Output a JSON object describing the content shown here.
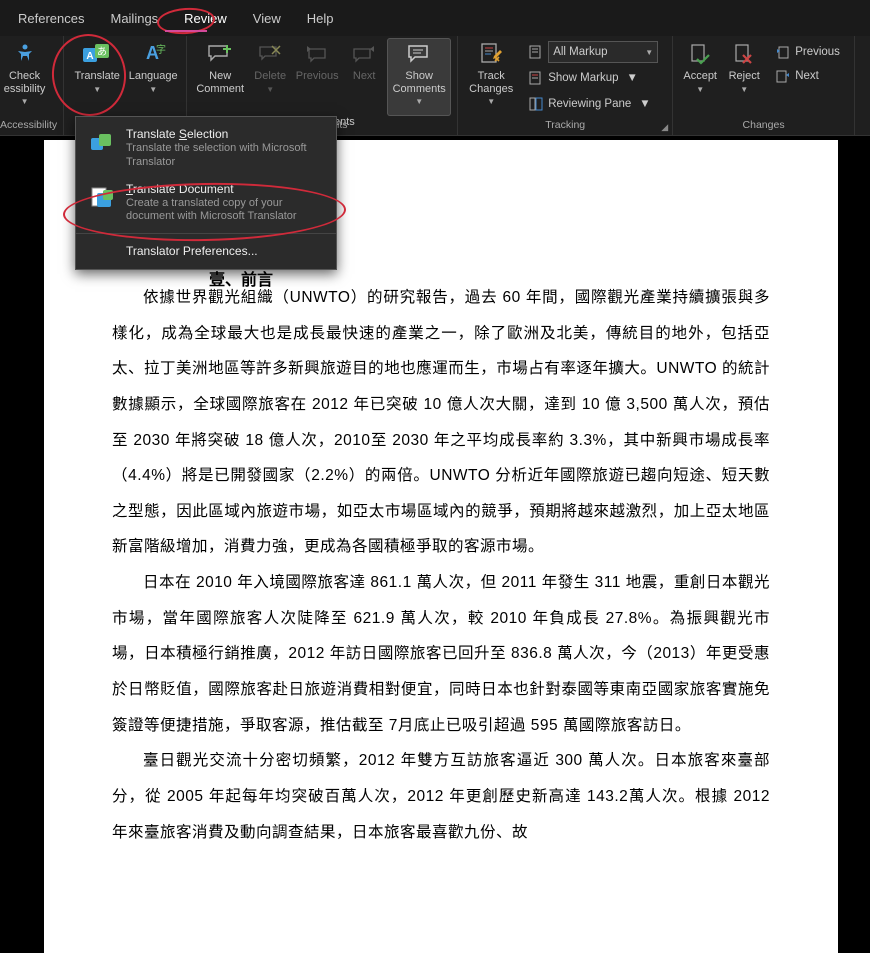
{
  "tabs": {
    "references": "References",
    "mailings": "Mailings",
    "review": "Review",
    "view": "View",
    "help": "Help"
  },
  "ribbon": {
    "check_accessibility": "Check\nessibility",
    "translate": "Translate",
    "language": "Language",
    "new_comment": "New\nComment",
    "delete": "Delete",
    "previous": "Previous",
    "next": "Next",
    "show_comments": "Show\nComments",
    "track_changes": "Track\nChanges",
    "all_markup": "All Markup",
    "show_markup": "Show Markup",
    "reviewing_pane": "Reviewing Pane",
    "accept": "Accept",
    "reject": "Reject",
    "prev2": "Previous",
    "next2": "Next",
    "group_comments_frag": "ents",
    "group_tracking": "Tracking",
    "group_changes": "Changes"
  },
  "menu": {
    "sel_title_pre": "Translate ",
    "sel_title_ul": "S",
    "sel_title_post": "election",
    "sel_desc": "Translate the selection with Microsoft Translator",
    "doc_title_ul": "T",
    "doc_title_post": "ranslate Document",
    "doc_desc": "Create a translated copy of your document with Microsoft Translator",
    "prefs": "Translator Preferences..."
  },
  "doc": {
    "heading_frag": "壹、前言",
    "p1": "依據世界觀光組織（UNWTO）的研究報告，過去 60 年間，國際觀光產業持續擴張與多樣化，成為全球最大也是成長最快速的產業之一，除了歐洲及北美，傳統目的地外，包括亞太、拉丁美洲地區等許多新興旅遊目的地也應運而生，市場占有率逐年擴大。UNWTO 的統計數據顯示，全球國際旅客在 2012 年已突破 10 億人次大關，達到 10 億 3,500 萬人次，預估至 2030 年將突破 18 億人次，2010至 2030 年之平均成長率約 3.3%，其中新興市場成長率（4.4%）將是已開發國家（2.2%）的兩倍。UNWTO 分析近年國際旅遊已趨向短途、短天數之型態，因此區域內旅遊市場，如亞太市場區域內的競爭，預期將越來越激烈，加上亞太地區新富階級增加，消費力強，更成為各國積極爭取的客源市場。",
    "p2": "日本在 2010 年入境國際旅客達 861.1 萬人次，但 2011 年發生 311 地震，重創日本觀光市場，當年國際旅客人次陡降至 621.9 萬人次，較 2010 年負成長 27.8%。為振興觀光市場，日本積極行銷推廣，2012 年訪日國際旅客已回升至 836.8 萬人次，今（2013）年更受惠於日幣貶值，國際旅客赴日旅遊消費相對便宜，同時日本也針對泰國等東南亞國家旅客實施免簽證等便捷措施，爭取客源，推估截至 7月底止已吸引超過 595 萬國際旅客訪日。",
    "p3": "臺日觀光交流十分密切頻繁，2012 年雙方互訪旅客逼近 300 萬人次。日本旅客來臺部分，從 2005 年起每年均突破百萬人次，2012 年更創歷史新高達 143.2萬人次。根據 2012 年來臺旅客消費及動向調查結果，日本旅客最喜歡九份、故"
  }
}
